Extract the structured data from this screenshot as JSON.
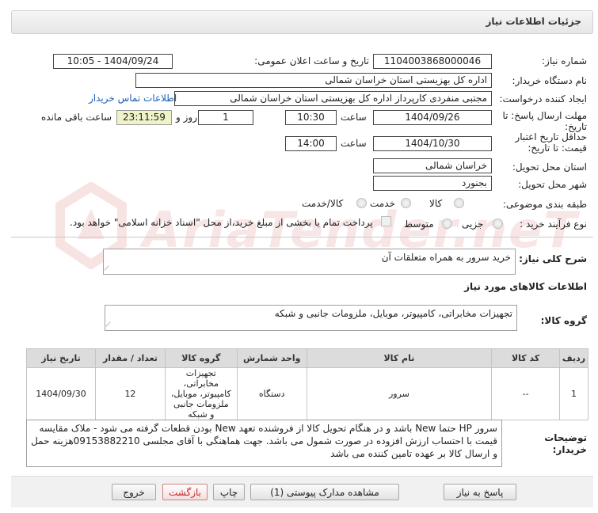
{
  "header": {
    "title": "جزئیات اطلاعات نیاز"
  },
  "watermark": {
    "text": "AriaTender.neT"
  },
  "form": {
    "need_number_label": "شماره نیاز:",
    "need_number": "1104003868000046",
    "announce_label": "تاریخ و ساعت اعلان عمومی:",
    "announce_value": "1404/09/24 - 10:05",
    "buyer_label": "نام دستگاه خریدار:",
    "buyer_value": "اداره کل بهزیستی استان خراسان شمالی",
    "requester_label": "ایجاد کننده درخواست:",
    "requester_value": "مجتبی منفردی کارپرداز اداره کل بهزیستی استان خراسان شمالی",
    "contact_link": "اطلاعات تماس خریدار",
    "deadline_label_1": "مهلت ارسال پاسخ: تا",
    "deadline_label_2": "تاریخ:",
    "deadline_date": "1404/09/26",
    "time_label": "ساعت",
    "deadline_time": "10:30",
    "days_value": "1",
    "days_label": "روز و",
    "remaining_time": "23:11:59",
    "remaining_label": "ساعت باقی مانده",
    "validity_label_1": "حداقل تاریخ اعتبار",
    "validity_label_2": "قیمت: تا تاریخ:",
    "validity_date": "1404/10/30",
    "validity_time": "14:00",
    "province_label": "استان محل تحویل:",
    "province_value": "خراسان شمالی",
    "city_label": "شهر محل تحویل:",
    "city_value": "بجنورد",
    "category_label": "طبقه بندی موضوعی:",
    "category_options": [
      "کالا",
      "خدمت",
      "کالا/خدمت"
    ],
    "process_label": "نوع فرآیند خرید :",
    "process_options": [
      "جزیی",
      "متوسط"
    ],
    "payment_note": "پرداخت تمام یا بخشی از مبلغ خرید،از محل \"اسناد خزانه اسلامی\" خواهد بود.",
    "summary_label": "شرح کلی نیاز:",
    "summary_value": "خرید سرور به همراه متعلقات آن",
    "goods_info_title": "اطلاعات کالاهای مورد نیاز",
    "goods_group_label": "گروه کالا:",
    "goods_group_value": "تجهیزات مخابراتی، کامپیوتر، موبایل، ملزومات جانبی و شبکه"
  },
  "table": {
    "headers": [
      "ردیف",
      "کد کالا",
      "نام کالا",
      "واحد شمارش",
      "گروه کالا",
      "تعداد / مقدار",
      "تاریخ نیاز"
    ],
    "rows": [
      {
        "row": "1",
        "code": "--",
        "name": "سرور",
        "unit": "دستگاه",
        "group": "تجهیزات مخابراتی، کامپیوتر، موبایل، ملزومات جانبی و شبکه",
        "qty": "12",
        "date": "1404/09/30"
      }
    ]
  },
  "notes": {
    "label_1": "توضیحات",
    "label_2": "خریدار:",
    "text": "سرور HP  حتما New باشد و در هنگام تحویل کالا از فروشنده تعهد New بودن قطعات گرفته می شود - ملاک مقایسه قیمت با احتساب ارزش افزوده در صورت شمول می باشد. جهت هماهنگی با آقای مجلسی 09153882210هزینه حمل و ارسال کالا بر عهده تامین کننده می باشد"
  },
  "buttons": {
    "reply": "پاسخ به نیاز",
    "docs": "مشاهده مدارک پیوستی (1)",
    "print": "چاپ",
    "back": "بازگشت",
    "exit": "خروج"
  }
}
